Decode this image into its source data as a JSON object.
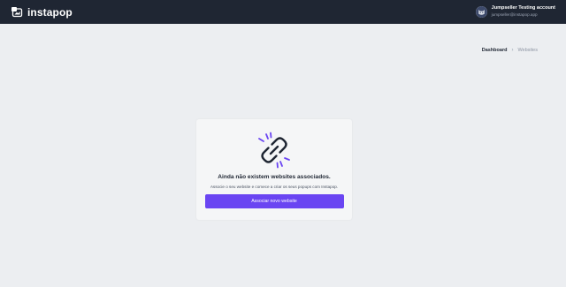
{
  "app": {
    "name": "instapop"
  },
  "account": {
    "name": "Jumpseller Testing account",
    "email": "jumpseller@instapop.app"
  },
  "breadcrumb": {
    "items": [
      "Dashboard",
      "Websites"
    ],
    "separator": "›"
  },
  "empty_state": {
    "icon": "broken-link-icon",
    "title": "Ainda não existem websites associados.",
    "description": "Associe o seu website e comece a criar os seus popups com Instapop.",
    "button_label": "Associar novo website"
  },
  "colors": {
    "topbar": "#1f2633",
    "background": "#eceef1",
    "card": "#f5f6f7",
    "accent": "#6a45f2"
  }
}
